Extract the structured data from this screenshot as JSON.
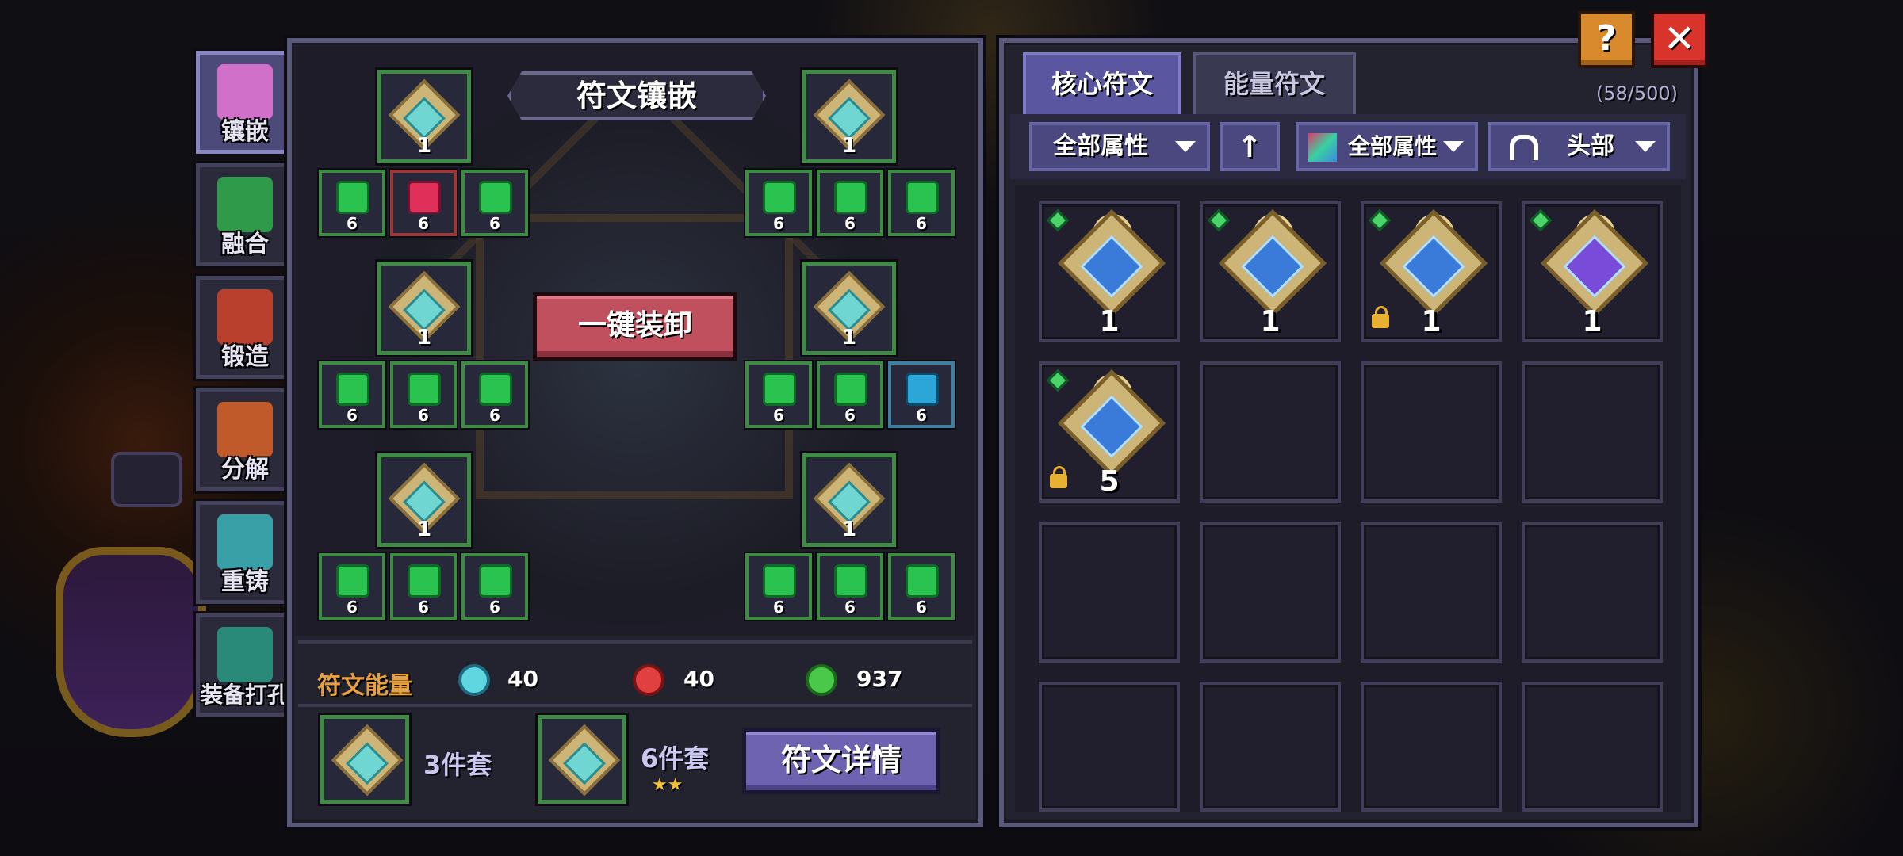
{
  "side_tabs": [
    {
      "label": "镶嵌",
      "icon": "inlay-icon",
      "active": true
    },
    {
      "label": "融合",
      "icon": "fusion-icon"
    },
    {
      "label": "锻造",
      "icon": "forge-icon"
    },
    {
      "label": "分解",
      "icon": "decompose-icon"
    },
    {
      "label": "重铸",
      "icon": "recast-icon"
    },
    {
      "label": "装备打孔",
      "icon": "punch-icon"
    }
  ],
  "inlay": {
    "title": "符文镶嵌",
    "core_levels": [
      "1",
      "1",
      "1",
      "1",
      "1",
      "1"
    ],
    "small_level": "6",
    "unequip_label": "一键装卸",
    "energy_label": "符文能量",
    "energy": {
      "blue": "40",
      "red": "40",
      "green": "937"
    },
    "sets": [
      {
        "label": "3件套"
      },
      {
        "label": "6件套",
        "stars": "★★"
      }
    ],
    "details_label": "符文详情"
  },
  "inventory": {
    "tabs": [
      "核心符文",
      "能量符文"
    ],
    "count": "(58/500)",
    "filters": {
      "attr_left": "全部属性",
      "sort_icon": "arrow-up-icon",
      "attr_right": "全部属性",
      "slot": "头部"
    },
    "items": [
      {
        "level": "1",
        "variant": "blue",
        "locked": false
      },
      {
        "level": "1",
        "variant": "blue",
        "locked": false
      },
      {
        "level": "1",
        "variant": "blue",
        "locked": true
      },
      {
        "level": "1",
        "variant": "purple",
        "locked": false
      },
      {
        "level": "5",
        "variant": "blue",
        "locked": true
      }
    ]
  },
  "top_buttons": {
    "help": "?",
    "close": "✕"
  },
  "colors": {
    "accent": "#5a57a0",
    "green_frame": "#3f8a44",
    "danger": "#c0505e",
    "energy_label": "#e8a040"
  }
}
